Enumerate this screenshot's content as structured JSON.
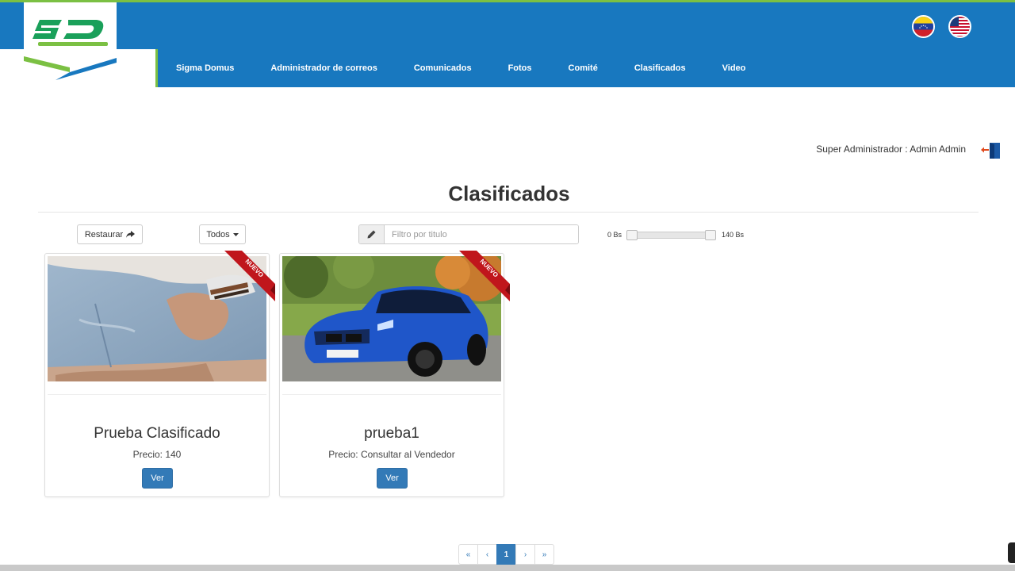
{
  "colors": {
    "brand_blue": "#1878bf",
    "brand_green": "#7bc043",
    "primary": "#337ab7",
    "ribbon_red": "#c0161c"
  },
  "logo": {
    "text": "SD",
    "icon": "sigma-domus-logo"
  },
  "flags": [
    {
      "name": "venezuela-flag-icon"
    },
    {
      "name": "usa-flag-icon"
    }
  ],
  "menu": [
    {
      "label": "Sigma Domus"
    },
    {
      "label": "Administrador de correos"
    },
    {
      "label": "Comunicados"
    },
    {
      "label": "Fotos"
    },
    {
      "label": "Comité"
    },
    {
      "label": "Clasificados"
    },
    {
      "label": "Video"
    }
  ],
  "user": {
    "label": "Super Administrador : Admin Admin",
    "logout_icon": "logout-door-icon"
  },
  "page": {
    "title": "Clasificados"
  },
  "toolbar": {
    "restore_label": "Restaurar",
    "filter_label": "Todos",
    "search_placeholder": "Filtro por titulo",
    "price_min": "0 Bs",
    "price_max": "140 Bs",
    "price_range": [
      0,
      140
    ]
  },
  "cards": [
    {
      "title": "Prueba Clasificado",
      "price": "Precio: 140",
      "badge": "NUEVO",
      "button": "Ver",
      "image": "jeans-shorts-photo"
    },
    {
      "title": "prueba1",
      "price": "Precio: Consultar al Vendedor",
      "badge": "NUEVO",
      "button": "Ver",
      "image": "blue-bmw-car-photo"
    }
  ],
  "pagination": {
    "first": "«",
    "prev": "‹",
    "current": "1",
    "next": "›",
    "last": "»"
  }
}
